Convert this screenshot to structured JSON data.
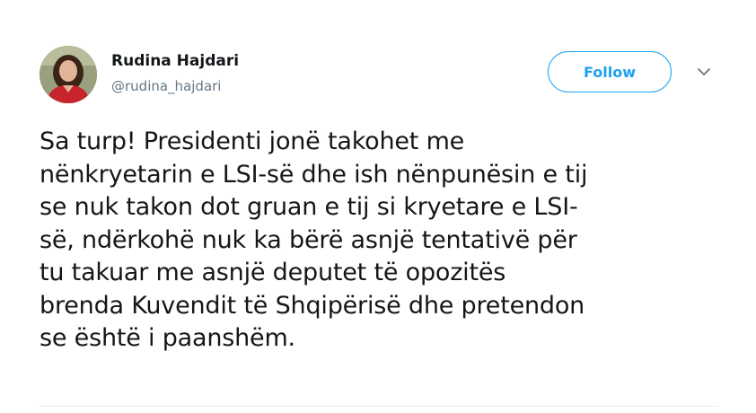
{
  "user": {
    "name": "Rudina Hajdari",
    "handle": "@rudina_hajdari"
  },
  "actions": {
    "follow_label": "Follow",
    "menu_icon": "chevron-down-icon"
  },
  "tweet": {
    "lines": [
      "Sa turp! Presidenti jonë takohet me",
      "nënkryetarin e LSI-së dhe ish nënpunësin e tij",
      "se nuk takon dot gruan e tij si kryetare e LSI-",
      "së, ndërkohë nuk ka bërë asnjë tentativë për",
      "tu takuar me asnjë deputet të opozitës",
      "brenda Kuvendit të Shqipërisë dhe pretendon",
      "se është i paanshëm."
    ]
  },
  "colors": {
    "accent": "#1da1f2",
    "secondary_text": "#657786",
    "primary_text": "#14171a"
  }
}
